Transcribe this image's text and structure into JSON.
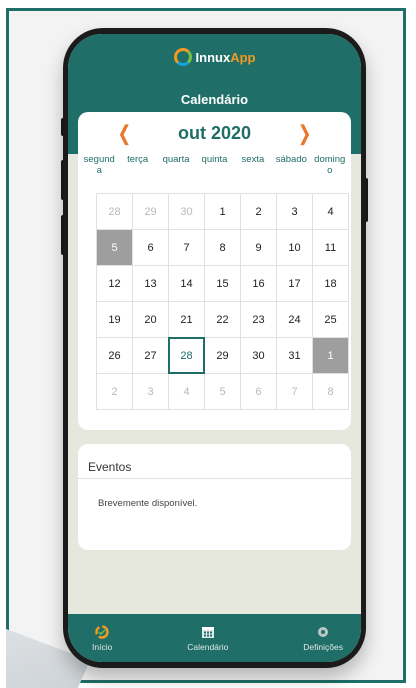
{
  "app": {
    "brand_first": "Innux",
    "brand_second": "App"
  },
  "header": {
    "title": "Calendário"
  },
  "calendar": {
    "prev_icon": "chevron-left",
    "next_icon": "chevron-right",
    "month_label": "out 2020",
    "weekdays": [
      "segund\na",
      "terça",
      "quarta",
      "quinta",
      "sexta",
      "sábado",
      "doming\no"
    ],
    "weeks": [
      [
        {
          "d": "28",
          "s": "other"
        },
        {
          "d": "29",
          "s": "other"
        },
        {
          "d": "30",
          "s": "other"
        },
        {
          "d": "1",
          "s": ""
        },
        {
          "d": "2",
          "s": ""
        },
        {
          "d": "3",
          "s": ""
        },
        {
          "d": "4",
          "s": ""
        }
      ],
      [
        {
          "d": "5",
          "s": "gray"
        },
        {
          "d": "6",
          "s": ""
        },
        {
          "d": "7",
          "s": ""
        },
        {
          "d": "8",
          "s": ""
        },
        {
          "d": "9",
          "s": ""
        },
        {
          "d": "10",
          "s": ""
        },
        {
          "d": "11",
          "s": ""
        }
      ],
      [
        {
          "d": "12",
          "s": ""
        },
        {
          "d": "13",
          "s": ""
        },
        {
          "d": "14",
          "s": ""
        },
        {
          "d": "15",
          "s": ""
        },
        {
          "d": "16",
          "s": ""
        },
        {
          "d": "17",
          "s": ""
        },
        {
          "d": "18",
          "s": ""
        }
      ],
      [
        {
          "d": "19",
          "s": ""
        },
        {
          "d": "20",
          "s": ""
        },
        {
          "d": "21",
          "s": ""
        },
        {
          "d": "22",
          "s": ""
        },
        {
          "d": "23",
          "s": ""
        },
        {
          "d": "24",
          "s": ""
        },
        {
          "d": "25",
          "s": ""
        }
      ],
      [
        {
          "d": "26",
          "s": ""
        },
        {
          "d": "27",
          "s": ""
        },
        {
          "d": "28",
          "s": "today"
        },
        {
          "d": "29",
          "s": ""
        },
        {
          "d": "30",
          "s": ""
        },
        {
          "d": "31",
          "s": ""
        },
        {
          "d": "1",
          "s": "gray"
        }
      ],
      [
        {
          "d": "2",
          "s": "other"
        },
        {
          "d": "3",
          "s": "other"
        },
        {
          "d": "4",
          "s": "other"
        },
        {
          "d": "5",
          "s": "other"
        },
        {
          "d": "6",
          "s": "other"
        },
        {
          "d": "7",
          "s": "other"
        },
        {
          "d": "8",
          "s": "other"
        }
      ]
    ]
  },
  "events": {
    "title": "Eventos",
    "message": "Brevemente disponível."
  },
  "tabs": [
    {
      "label": "Início",
      "icon": "app-logo-icon"
    },
    {
      "label": "Calendário",
      "icon": "calendar-icon"
    },
    {
      "label": "Definições",
      "icon": "gear-icon"
    }
  ],
  "colors": {
    "primary": "#1f6e68",
    "accent": "#e8782a",
    "brand_orange": "#f39a21",
    "background": "#e6e8dd"
  }
}
